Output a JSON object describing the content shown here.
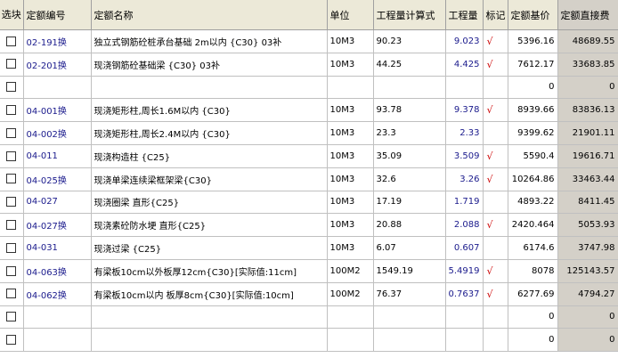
{
  "headers": {
    "select": "选块",
    "code": "定额编号",
    "name": "定额名称",
    "unit": "单位",
    "formula": "工程量计算式",
    "quantity": "工程量",
    "mark": "标记",
    "base_price": "定额基价",
    "direct_cost": "定额直接费"
  },
  "rows": [
    {
      "code": "02-191换",
      "name": "独立式钢筋砼桩承台基础 2m以内 {C30} 03补",
      "unit": "10M3",
      "formula": "90.23",
      "quantity": "9.023",
      "mark": "√",
      "base_price": "5396.16",
      "direct_cost": "48689.55"
    },
    {
      "code": "02-201换",
      "name": "现浇钢筋砼基础梁 {C30} 03补",
      "unit": "10M3",
      "formula": "44.25",
      "quantity": "4.425",
      "mark": "√",
      "base_price": "7612.17",
      "direct_cost": "33683.85"
    },
    {
      "code": "",
      "name": "",
      "unit": "",
      "formula": "",
      "quantity": "",
      "mark": "",
      "base_price": "0",
      "direct_cost": "0"
    },
    {
      "code": "04-001换",
      "name": "现浇矩形柱,周长1.6M以内 {C30}",
      "unit": "10M3",
      "formula": "93.78",
      "quantity": "9.378",
      "mark": "√",
      "base_price": "8939.66",
      "direct_cost": "83836.13"
    },
    {
      "code": "04-002换",
      "name": "现浇矩形柱,周长2.4M以内 {C30}",
      "unit": "10M3",
      "formula": "23.3",
      "quantity": "2.33",
      "mark": "",
      "base_price": "9399.62",
      "direct_cost": "21901.11"
    },
    {
      "code": "04-011",
      "name": "现浇构造柱 {C25}",
      "unit": "10M3",
      "formula": "35.09",
      "quantity": "3.509",
      "mark": "√",
      "base_price": "5590.4",
      "direct_cost": "19616.71"
    },
    {
      "code": "04-025换",
      "name": "现浇单梁连续梁框架梁{C30}",
      "unit": "10M3",
      "formula": "32.6",
      "quantity": "3.26",
      "mark": "√",
      "base_price": "10264.86",
      "direct_cost": "33463.44"
    },
    {
      "code": "04-027",
      "name": "现浇圈梁 直形{C25}",
      "unit": "10M3",
      "formula": "17.19",
      "quantity": "1.719",
      "mark": "",
      "base_price": "4893.22",
      "direct_cost": "8411.45"
    },
    {
      "code": "04-027换",
      "name": "现浇素砼防水埂 直形{C25}",
      "unit": "10M3",
      "formula": "20.88",
      "quantity": "2.088",
      "mark": "√",
      "base_price": "2420.464",
      "direct_cost": "5053.93"
    },
    {
      "code": "04-031",
      "name": "现浇过梁   {C25}",
      "unit": "10M3",
      "formula": "6.07",
      "quantity": "0.607",
      "mark": "",
      "base_price": "6174.6",
      "direct_cost": "3747.98"
    },
    {
      "code": "04-063换",
      "name": "有梁板10cm以外板厚12cm{C30}[实际值:11cm]",
      "unit": "100M2",
      "formula": "1549.19",
      "quantity": "5.4919",
      "mark": "√",
      "base_price": "8078",
      "direct_cost": "125143.57"
    },
    {
      "code": "04-062换",
      "name": "有梁板10cm以内 板厚8cm{C30}[实际值:10cm]",
      "unit": "100M2",
      "formula": "76.37",
      "quantity": "0.7637",
      "mark": "√",
      "base_price": "6277.69",
      "direct_cost": "4794.27"
    },
    {
      "code": "",
      "name": "",
      "unit": "",
      "formula": "",
      "quantity": "",
      "mark": "",
      "base_price": "0",
      "direct_cost": "0"
    },
    {
      "code": "",
      "name": "",
      "unit": "",
      "formula": "",
      "quantity": "",
      "mark": "",
      "base_price": "0",
      "direct_cost": "0"
    }
  ]
}
